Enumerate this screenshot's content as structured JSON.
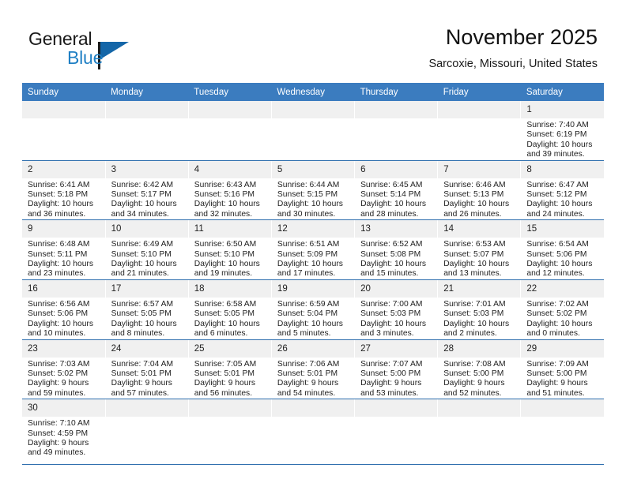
{
  "brand": {
    "name_part1": "General",
    "name_part2": "Blue",
    "logo_icon": "blue-triangle-logo"
  },
  "header": {
    "title": "November 2025",
    "location": "Sarcoxie, Missouri, United States"
  },
  "colors": {
    "header_band": "#3b7cbf",
    "row_divider": "#2f6fae",
    "daynum_band": "#f0f0f0",
    "brand_blue": "#1f7fc4",
    "text": "#222222"
  },
  "weekdays": [
    "Sunday",
    "Monday",
    "Tuesday",
    "Wednesday",
    "Thursday",
    "Friday",
    "Saturday"
  ],
  "labels": {
    "sunrise_prefix": "Sunrise:",
    "sunset_prefix": "Sunset:",
    "daylight_prefix": "Daylight:"
  },
  "weeks": [
    [
      {
        "empty": true,
        "day": ""
      },
      {
        "empty": true,
        "day": ""
      },
      {
        "empty": true,
        "day": ""
      },
      {
        "empty": true,
        "day": ""
      },
      {
        "empty": true,
        "day": ""
      },
      {
        "empty": true,
        "day": ""
      },
      {
        "empty": false,
        "day": "1",
        "sunrise": "Sunrise: 7:40 AM",
        "sunset": "Sunset: 6:19 PM",
        "daylight": "Daylight: 10 hours and 39 minutes."
      }
    ],
    [
      {
        "empty": false,
        "day": "2",
        "sunrise": "Sunrise: 6:41 AM",
        "sunset": "Sunset: 5:18 PM",
        "daylight": "Daylight: 10 hours and 36 minutes."
      },
      {
        "empty": false,
        "day": "3",
        "sunrise": "Sunrise: 6:42 AM",
        "sunset": "Sunset: 5:17 PM",
        "daylight": "Daylight: 10 hours and 34 minutes."
      },
      {
        "empty": false,
        "day": "4",
        "sunrise": "Sunrise: 6:43 AM",
        "sunset": "Sunset: 5:16 PM",
        "daylight": "Daylight: 10 hours and 32 minutes."
      },
      {
        "empty": false,
        "day": "5",
        "sunrise": "Sunrise: 6:44 AM",
        "sunset": "Sunset: 5:15 PM",
        "daylight": "Daylight: 10 hours and 30 minutes."
      },
      {
        "empty": false,
        "day": "6",
        "sunrise": "Sunrise: 6:45 AM",
        "sunset": "Sunset: 5:14 PM",
        "daylight": "Daylight: 10 hours and 28 minutes."
      },
      {
        "empty": false,
        "day": "7",
        "sunrise": "Sunrise: 6:46 AM",
        "sunset": "Sunset: 5:13 PM",
        "daylight": "Daylight: 10 hours and 26 minutes."
      },
      {
        "empty": false,
        "day": "8",
        "sunrise": "Sunrise: 6:47 AM",
        "sunset": "Sunset: 5:12 PM",
        "daylight": "Daylight: 10 hours and 24 minutes."
      }
    ],
    [
      {
        "empty": false,
        "day": "9",
        "sunrise": "Sunrise: 6:48 AM",
        "sunset": "Sunset: 5:11 PM",
        "daylight": "Daylight: 10 hours and 23 minutes."
      },
      {
        "empty": false,
        "day": "10",
        "sunrise": "Sunrise: 6:49 AM",
        "sunset": "Sunset: 5:10 PM",
        "daylight": "Daylight: 10 hours and 21 minutes."
      },
      {
        "empty": false,
        "day": "11",
        "sunrise": "Sunrise: 6:50 AM",
        "sunset": "Sunset: 5:10 PM",
        "daylight": "Daylight: 10 hours and 19 minutes."
      },
      {
        "empty": false,
        "day": "12",
        "sunrise": "Sunrise: 6:51 AM",
        "sunset": "Sunset: 5:09 PM",
        "daylight": "Daylight: 10 hours and 17 minutes."
      },
      {
        "empty": false,
        "day": "13",
        "sunrise": "Sunrise: 6:52 AM",
        "sunset": "Sunset: 5:08 PM",
        "daylight": "Daylight: 10 hours and 15 minutes."
      },
      {
        "empty": false,
        "day": "14",
        "sunrise": "Sunrise: 6:53 AM",
        "sunset": "Sunset: 5:07 PM",
        "daylight": "Daylight: 10 hours and 13 minutes."
      },
      {
        "empty": false,
        "day": "15",
        "sunrise": "Sunrise: 6:54 AM",
        "sunset": "Sunset: 5:06 PM",
        "daylight": "Daylight: 10 hours and 12 minutes."
      }
    ],
    [
      {
        "empty": false,
        "day": "16",
        "sunrise": "Sunrise: 6:56 AM",
        "sunset": "Sunset: 5:06 PM",
        "daylight": "Daylight: 10 hours and 10 minutes."
      },
      {
        "empty": false,
        "day": "17",
        "sunrise": "Sunrise: 6:57 AM",
        "sunset": "Sunset: 5:05 PM",
        "daylight": "Daylight: 10 hours and 8 minutes."
      },
      {
        "empty": false,
        "day": "18",
        "sunrise": "Sunrise: 6:58 AM",
        "sunset": "Sunset: 5:05 PM",
        "daylight": "Daylight: 10 hours and 6 minutes."
      },
      {
        "empty": false,
        "day": "19",
        "sunrise": "Sunrise: 6:59 AM",
        "sunset": "Sunset: 5:04 PM",
        "daylight": "Daylight: 10 hours and 5 minutes."
      },
      {
        "empty": false,
        "day": "20",
        "sunrise": "Sunrise: 7:00 AM",
        "sunset": "Sunset: 5:03 PM",
        "daylight": "Daylight: 10 hours and 3 minutes."
      },
      {
        "empty": false,
        "day": "21",
        "sunrise": "Sunrise: 7:01 AM",
        "sunset": "Sunset: 5:03 PM",
        "daylight": "Daylight: 10 hours and 2 minutes."
      },
      {
        "empty": false,
        "day": "22",
        "sunrise": "Sunrise: 7:02 AM",
        "sunset": "Sunset: 5:02 PM",
        "daylight": "Daylight: 10 hours and 0 minutes."
      }
    ],
    [
      {
        "empty": false,
        "day": "23",
        "sunrise": "Sunrise: 7:03 AM",
        "sunset": "Sunset: 5:02 PM",
        "daylight": "Daylight: 9 hours and 59 minutes."
      },
      {
        "empty": false,
        "day": "24",
        "sunrise": "Sunrise: 7:04 AM",
        "sunset": "Sunset: 5:01 PM",
        "daylight": "Daylight: 9 hours and 57 minutes."
      },
      {
        "empty": false,
        "day": "25",
        "sunrise": "Sunrise: 7:05 AM",
        "sunset": "Sunset: 5:01 PM",
        "daylight": "Daylight: 9 hours and 56 minutes."
      },
      {
        "empty": false,
        "day": "26",
        "sunrise": "Sunrise: 7:06 AM",
        "sunset": "Sunset: 5:01 PM",
        "daylight": "Daylight: 9 hours and 54 minutes."
      },
      {
        "empty": false,
        "day": "27",
        "sunrise": "Sunrise: 7:07 AM",
        "sunset": "Sunset: 5:00 PM",
        "daylight": "Daylight: 9 hours and 53 minutes."
      },
      {
        "empty": false,
        "day": "28",
        "sunrise": "Sunrise: 7:08 AM",
        "sunset": "Sunset: 5:00 PM",
        "daylight": "Daylight: 9 hours and 52 minutes."
      },
      {
        "empty": false,
        "day": "29",
        "sunrise": "Sunrise: 7:09 AM",
        "sunset": "Sunset: 5:00 PM",
        "daylight": "Daylight: 9 hours and 51 minutes."
      }
    ],
    [
      {
        "empty": false,
        "day": "30",
        "sunrise": "Sunrise: 7:10 AM",
        "sunset": "Sunset: 4:59 PM",
        "daylight": "Daylight: 9 hours and 49 minutes."
      },
      {
        "empty": true,
        "day": ""
      },
      {
        "empty": true,
        "day": ""
      },
      {
        "empty": true,
        "day": ""
      },
      {
        "empty": true,
        "day": ""
      },
      {
        "empty": true,
        "day": ""
      },
      {
        "empty": true,
        "day": ""
      }
    ]
  ]
}
